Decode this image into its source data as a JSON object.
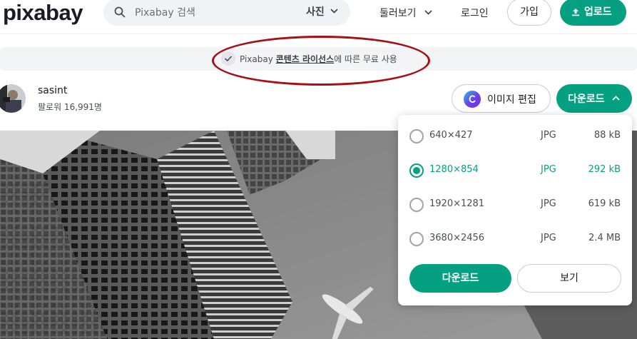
{
  "header": {
    "logo": "pixabay",
    "search_placeholder": "Pixabay 검색",
    "search_type": "사진",
    "browse_label": "둘러보기",
    "login_label": "로그인",
    "join_label": "가입",
    "upload_label": "업로드"
  },
  "license": {
    "prefix": "Pixabay ",
    "link": "콘텐츠 라이선스",
    "suffix": "에 따른 무료 사용"
  },
  "user": {
    "name": "sasint",
    "followers": "팔로워 16,991명"
  },
  "actions": {
    "edit_label": "이미지 편집",
    "download_label": "다운로드"
  },
  "download_menu": {
    "options": [
      {
        "size": "640×427",
        "format": "JPG",
        "filesize": "88 kB",
        "selected": false
      },
      {
        "size": "1280×854",
        "format": "JPG",
        "filesize": "292 kB",
        "selected": true
      },
      {
        "size": "1920×1281",
        "format": "JPG",
        "filesize": "619 kB",
        "selected": false
      },
      {
        "size": "3680×2456",
        "format": "JPG",
        "filesize": "2.4 MB",
        "selected": false
      }
    ],
    "download_label": "다운로드",
    "view_label": "보기"
  },
  "colors": {
    "accent": "#05a081",
    "annotation": "#a80e16"
  },
  "icons": {
    "search": "search-icon",
    "chevron": "chevron-down-icon",
    "upload": "upload-icon",
    "check": "check-icon",
    "canva": "canva-icon",
    "chevron_up": "chevron-up-icon"
  }
}
